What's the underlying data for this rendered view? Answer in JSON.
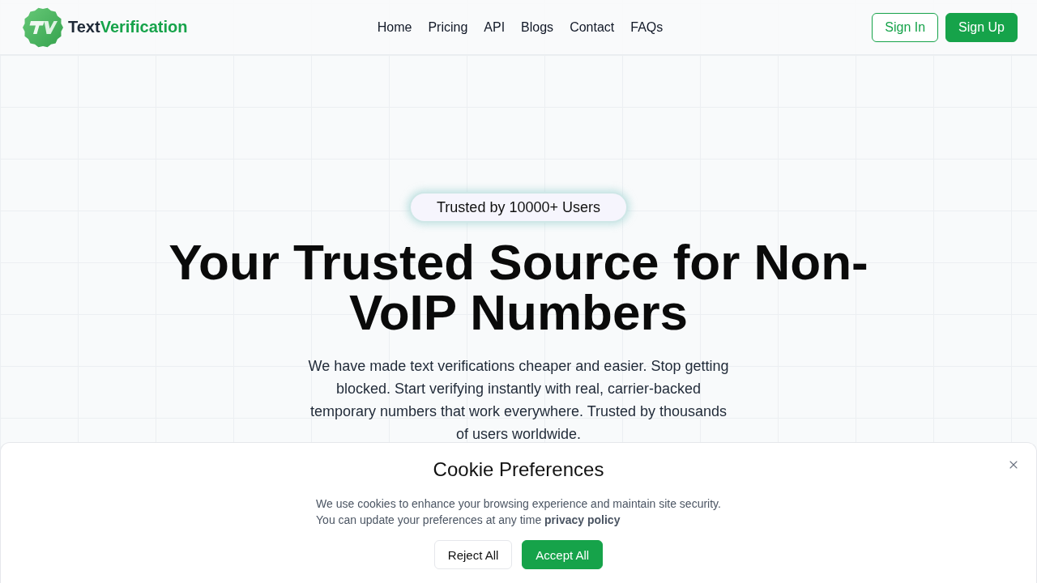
{
  "header": {
    "brand": {
      "prefix": "Text",
      "highlight": "Verification"
    },
    "nav": [
      {
        "label": "Home"
      },
      {
        "label": "Pricing"
      },
      {
        "label": "API"
      },
      {
        "label": "Blogs"
      },
      {
        "label": "Contact"
      },
      {
        "label": "FAQs"
      }
    ],
    "actions": [
      {
        "label": "Sign In",
        "kind": "secondary"
      },
      {
        "label": "Sign Up",
        "kind": "primary"
      }
    ]
  },
  "hero": {
    "badge": "Trusted by 10000+ Users",
    "title": "Your Trusted Source for Non-VoIP Numbers",
    "description": "We have made text verifications cheaper and easier. Stop getting blocked. Start verifying instantly with real, carrier-backed temporary numbers that work everywhere. Trusted by thousands of users worldwide."
  },
  "cookie_banner": {
    "title": "Cookie Preferences",
    "message_lines": [
      "We use cookies to enhance your browsing experience and maintain site security.",
      "You can update your preferences at any time"
    ],
    "link": "privacy policy",
    "buttons": [
      {
        "label": "Reject All",
        "kind": "secondary"
      },
      {
        "label": "Accept All",
        "kind": "primary"
      }
    ]
  }
}
